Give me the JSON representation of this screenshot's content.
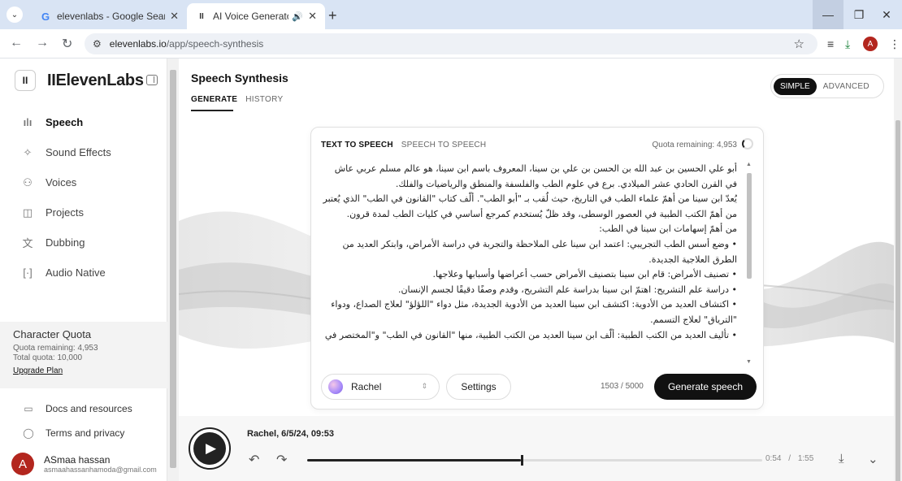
{
  "browser": {
    "tabs": [
      {
        "title": "elevenlabs - Google Search",
        "favicon": "G"
      },
      {
        "title": "AI Voice Generator & Text to Speech",
        "favicon": "II"
      }
    ],
    "url_host": "elevenlabs.io",
    "url_path": "/app/speech-synthesis",
    "profile_initial": "A"
  },
  "sidebar": {
    "brand": "IIElevenLabs",
    "brand_mark": "II",
    "items": [
      {
        "label": "Speech",
        "icon": "waveform-icon"
      },
      {
        "label": "Sound Effects",
        "icon": "sparkle-icon"
      },
      {
        "label": "Voices",
        "icon": "people-icon"
      },
      {
        "label": "Projects",
        "icon": "book-icon"
      },
      {
        "label": "Dubbing",
        "icon": "translate-icon"
      },
      {
        "label": "Audio Native",
        "icon": "embed-icon"
      }
    ],
    "quota": {
      "title": "Character Quota",
      "remaining": "Quota remaining: 4,953",
      "total": "Total quota: 10,000",
      "upgrade": "Upgrade Plan"
    },
    "docs": "Docs and resources",
    "terms": "Terms and privacy",
    "user": {
      "initial": "A",
      "name": "ASmaa hassan",
      "email": "asmaahassanhamoda@gmail.com"
    }
  },
  "main": {
    "title": "Speech Synthesis",
    "tabs": [
      "GENERATE",
      "HISTORY"
    ],
    "mode": {
      "simple": "SIMPLE",
      "advanced": "ADVANCED"
    },
    "card": {
      "tabs": [
        "TEXT TO SPEECH",
        "SPEECH TO SPEECH"
      ],
      "quota_remaining": "Quota remaining: 4,953",
      "text": "أبو علي الحسين بن عبد الله بن الحسن بن علي بن سينا، المعروف باسم ابن سينا، هو عالم مسلم عربي عاش في القرن الحادي عشر الميلادي. برع في علوم الطب والفلسفة والمنطق والرياضيات والفلك.\nيُعدّ ابن سينا من أهمّ علماء الطب في التاريخ، حيث لُقب بـ \"أبو الطب\". ألّف كتاب \"القانون في الطب\" الذي يُعتبر من أهمّ الكتب الطبية في العصور الوسطى، وقد ظلّ يُستخدم كمرجع أساسي في كليات الطب لمدة قرون.\nمن أهمّ إسهامات ابن سينا في الطب:\n• وضع أسس الطب التجريبي: اعتمد ابن سينا على الملاحظة والتجربة في دراسة الأمراض، وابتكر العديد من الطرق العلاجية الجديدة.\n• تصنيف الأمراض: قام ابن سينا بتصنيف الأمراض حسب أعراضها وأسبابها وعلاجها.\n• دراسة علم التشريح: اهتمّ ابن سينا بدراسة علم التشريح، وقدم وصفًا دقيقًا لجسم الإنسان.\n• اكتشاف العديد من الأدوية: اكتشف ابن سينا العديد من الأدوية الجديدة، مثل دواء \"اللؤلؤ\" لعلاج الصداع، ودواء \"الترياق\" لعلاج التسمم.\n• تأليف العديد من الكتب الطبية: ألّف ابن سينا العديد من الكتب الطبية، منها \"القانون في الطب\" و\"المختصر في",
      "voice": "Rachel",
      "settings": "Settings",
      "char_count": "1503 / 5000",
      "generate": "Generate speech"
    },
    "player": {
      "title": "Rachel, 6/5/24, 09:53",
      "current": "0:54",
      "separator": "/",
      "duration": "1:55",
      "progress_fraction": 0.47
    }
  }
}
